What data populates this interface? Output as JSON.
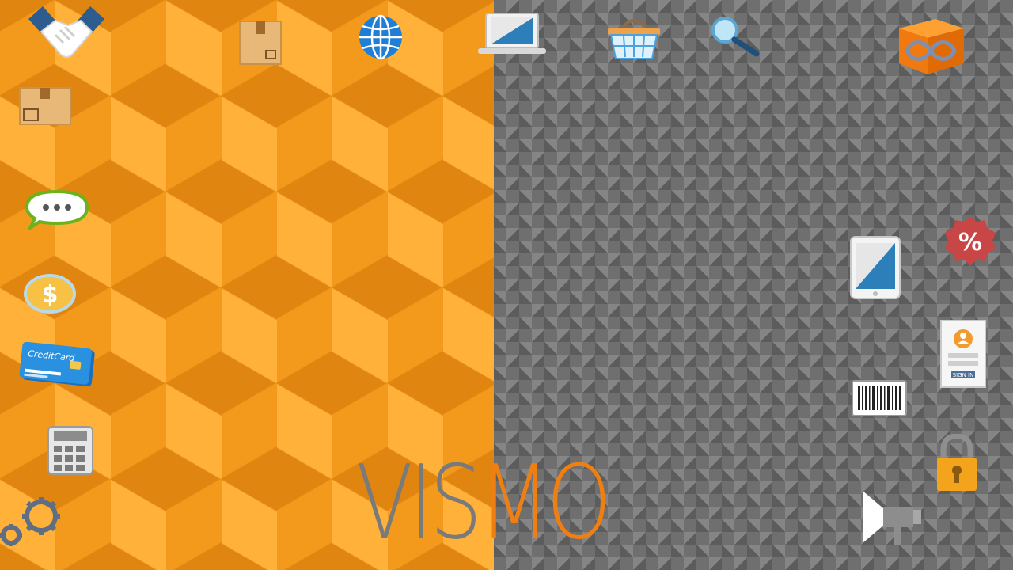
{
  "brand": {
    "logo_part_1": "VIS",
    "logo_part_2": "MO",
    "color_part_1": "#7a7a7a",
    "color_part_2": "#f07f12"
  },
  "background": {
    "left_color": "#f39a1c",
    "right_color": "#6f6f6f"
  },
  "icons": [
    "handshake-icon",
    "package-box-icon",
    "globe-icon",
    "laptop-icon",
    "shopping-basket-icon",
    "magnifier-icon",
    "infinity-cube-icon",
    "chat-bubble-icon",
    "dollar-coin-icon",
    "credit-card-icon",
    "calculator-icon",
    "gears-icon",
    "tablet-icon",
    "percent-badge-icon",
    "sign-in-form-icon",
    "barcode-icon",
    "padlock-icon",
    "megaphone-icon"
  ],
  "credit_card": {
    "label": "CreditCard"
  },
  "sign_in_form": {
    "button_label": "SIGN IN"
  },
  "percent_badge": {
    "symbol": "%"
  },
  "coin": {
    "symbol": "$"
  }
}
